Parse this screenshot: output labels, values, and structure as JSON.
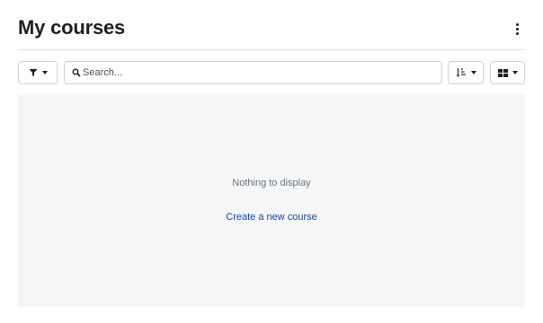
{
  "page": {
    "title": "My courses"
  },
  "header": {
    "menu_icon": "kebab-vertical-icon"
  },
  "toolbar": {
    "filter_icon": "filter-icon",
    "search_placeholder": "Search...",
    "search_value": "",
    "sort_icon": "sort-icon",
    "view_icon": "grid-view-icon"
  },
  "content": {
    "empty_message": "Nothing to display",
    "create_link": "Create a new course"
  },
  "colors": {
    "link": "#0f47ad",
    "empty_background": "#f5f6f7",
    "border": "#ced4da"
  }
}
